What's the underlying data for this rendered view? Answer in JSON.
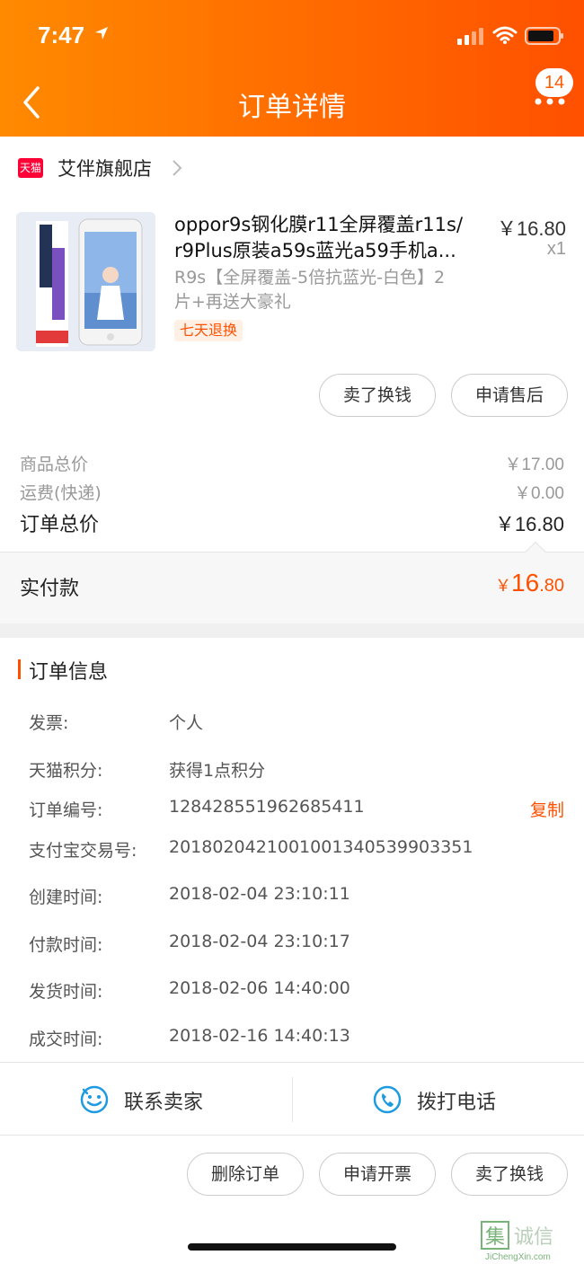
{
  "status_bar": {
    "time": "7:47"
  },
  "nav": {
    "title": "订单详情",
    "badge": "14"
  },
  "shop": {
    "tmall_tag": "天猫",
    "name": "艾伴旗舰店"
  },
  "product": {
    "title_line1": "oppor9s钢化膜r11全屏覆盖r11s/",
    "title_line2": "r9Plus原装a59s蓝光a59手机a...",
    "price": "￥16.80",
    "qty": "x1",
    "sku_line1": "R9s【全屏覆盖-5倍抗蓝光-白色】2",
    "sku_line2": "片+再送大豪礼",
    "tag": "七天退换",
    "actions": [
      "卖了换钱",
      "申请售后"
    ]
  },
  "summary": {
    "goods_total_label": "商品总价",
    "goods_total_value": "￥17.00",
    "shipping_label": "运费(快递)",
    "shipping_value": "￥0.00",
    "order_total_label": "订单总价",
    "order_total_value": "￥16.80",
    "paid_label": "实付款",
    "paid_currency": "￥",
    "paid_integer": "16",
    "paid_decimal": ".80"
  },
  "order_info": {
    "title": "订单信息",
    "copy_label": "复制",
    "rows": [
      {
        "label": "发票:",
        "value": "个人"
      },
      {
        "label": "天猫积分:",
        "value": "获得1点积分"
      },
      {
        "label": "订单编号:",
        "value": "128428551962685411"
      },
      {
        "label": "支付宝交易号:",
        "value": "2018020421001001340539903351"
      },
      {
        "label": "创建时间:",
        "value": "2018-02-04 23:10:11"
      },
      {
        "label": "付款时间:",
        "value": "2018-02-04 23:10:17"
      },
      {
        "label": "发货时间:",
        "value": "2018-02-06 14:40:00"
      },
      {
        "label": "成交时间:",
        "value": "2018-02-16 14:40:13"
      }
    ]
  },
  "contact": {
    "seller": "联系卖家",
    "phone": "拨打电话"
  },
  "bottom_actions": [
    "删除订单",
    "申请开票",
    "卖了换钱"
  ],
  "watermark": {
    "text": "JiChengXin.com"
  },
  "colors": {
    "accent": "#ff5000",
    "header_start": "#ff8a00",
    "header_end": "#ff5000",
    "tmall_red": "#ff0036",
    "icon_blue": "#1e9be0"
  },
  "icons": [
    "location-arrow-icon",
    "signal-icon",
    "wifi-icon",
    "battery-icon",
    "back-chevron-icon",
    "more-dots-icon",
    "tmall-icon",
    "chevron-right-icon",
    "chat-face-icon",
    "phone-icon"
  ]
}
